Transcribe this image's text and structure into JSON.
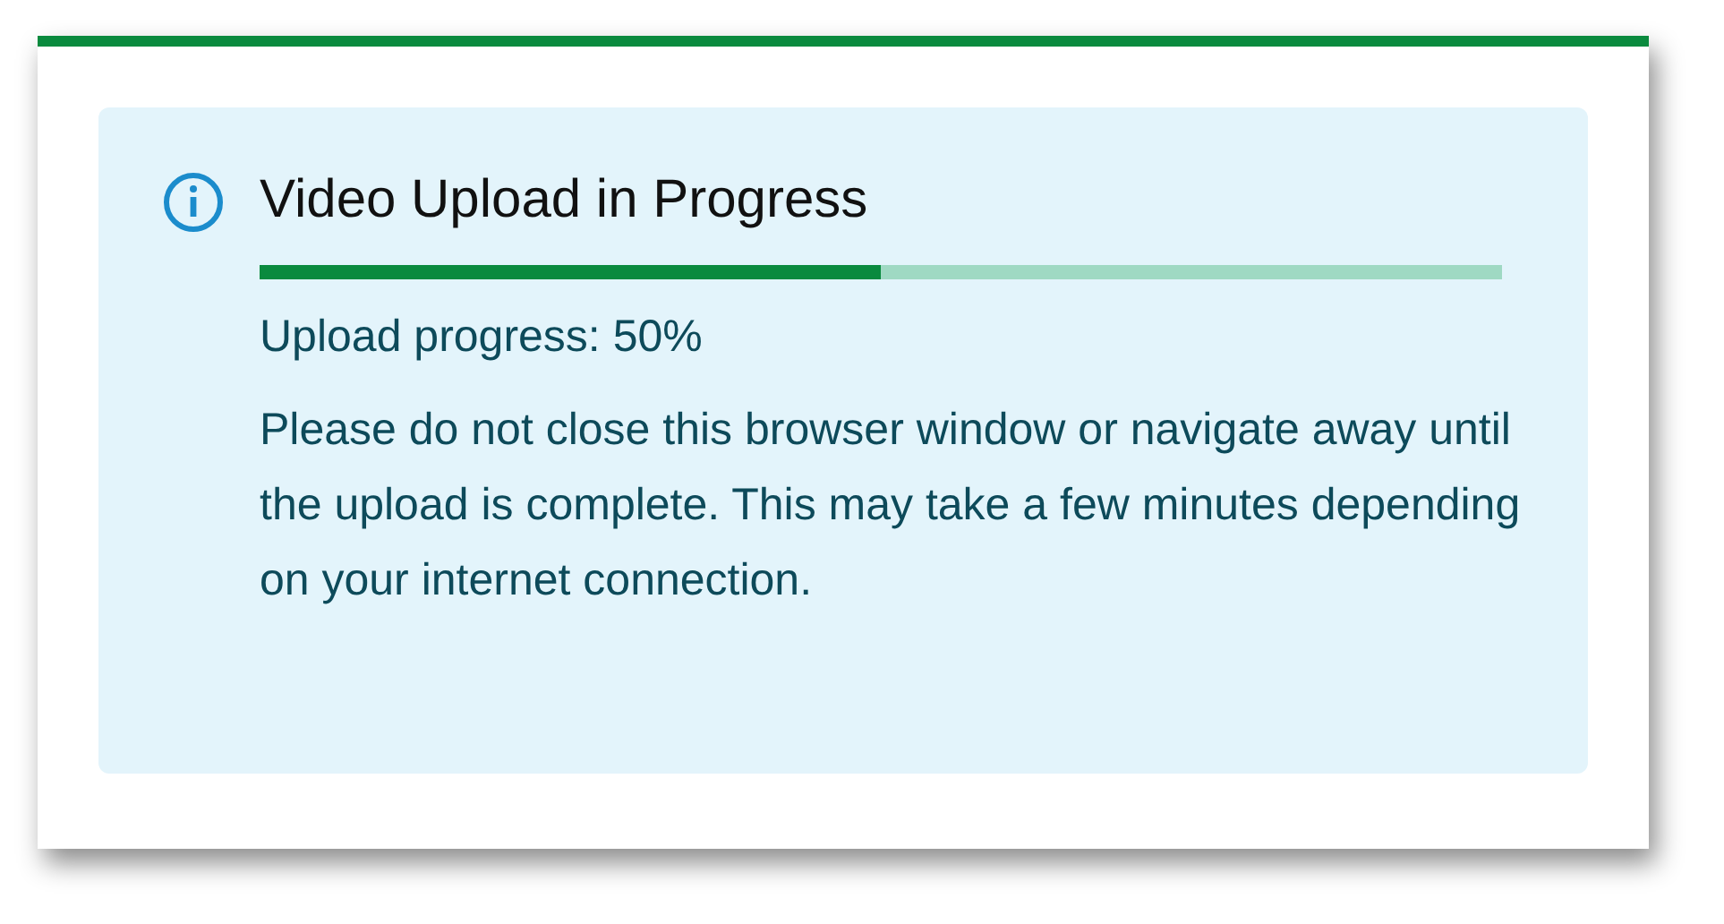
{
  "alert": {
    "title": "Video Upload in Progress",
    "progress": {
      "level": 0.5
    },
    "status": "Upload progress: 50%",
    "message": "Please do not close this browser window or navigate away until the upload is complete. This may take a few minutes depending on your internet connection."
  }
}
